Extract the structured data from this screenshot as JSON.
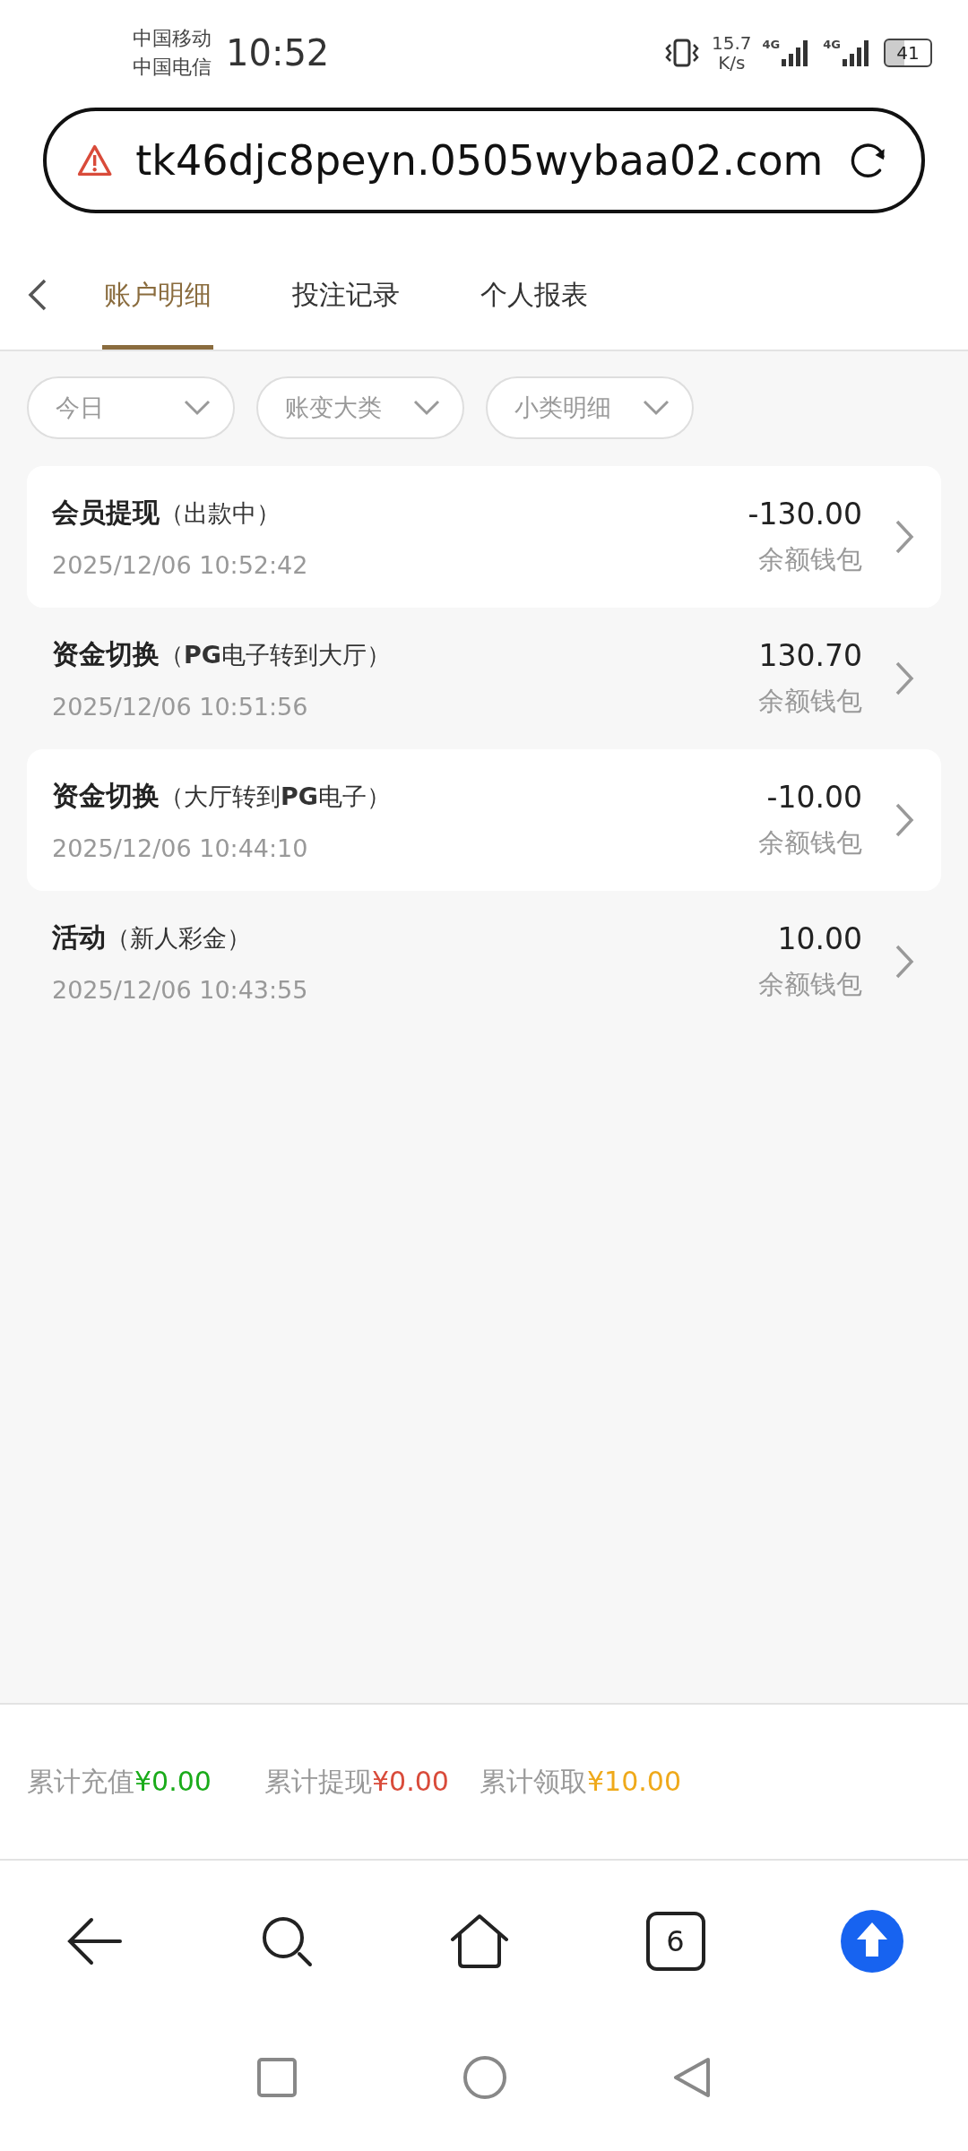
{
  "status_bar": {
    "carriers": [
      "中国移动",
      "中国电信"
    ],
    "time": "10:52",
    "speed_value": "15.7",
    "speed_unit": "K/s",
    "networks": [
      "4G",
      "4G"
    ],
    "battery": "41"
  },
  "address_bar": {
    "url": "tk46djc8peyn.0505wybaa02.com"
  },
  "tabs": [
    {
      "label": "账户明细",
      "selected": true
    },
    {
      "label": "投注记录",
      "selected": false
    },
    {
      "label": "个人报表",
      "selected": false
    }
  ],
  "filters": [
    {
      "label": "今日"
    },
    {
      "label": "账变大类"
    },
    {
      "label": "小类明细"
    }
  ],
  "records": [
    {
      "title": "会员提现",
      "detail": "（出款中）",
      "time": "2025/12/06 10:52:42",
      "amount": "-130.00",
      "wallet": "余额钱包"
    },
    {
      "title": "资金切换",
      "detail": "（**PG**电子转到大厅）",
      "time": "2025/12/06 10:51:56",
      "amount": "130.70",
      "wallet": "余额钱包"
    },
    {
      "title": "资金切换",
      "detail": "（大厅转到**PG**电子）",
      "time": "2025/12/06 10:44:10",
      "amount": "-10.00",
      "wallet": "余额钱包"
    },
    {
      "title": "活动",
      "detail": "（新人彩金）",
      "time": "2025/12/06 10:43:55",
      "amount": "10.00",
      "wallet": "余额钱包"
    }
  ],
  "summary": [
    {
      "label": "累计充值",
      "value": "¥0.00",
      "color": "#1aab1a"
    },
    {
      "label": "累计提现",
      "value": "¥0.00",
      "color": "#d94b3a"
    },
    {
      "label": "累计领取",
      "value": "¥10.00",
      "color": "#efa91a"
    }
  ],
  "browser_toolbar": {
    "tab_count": "6"
  }
}
